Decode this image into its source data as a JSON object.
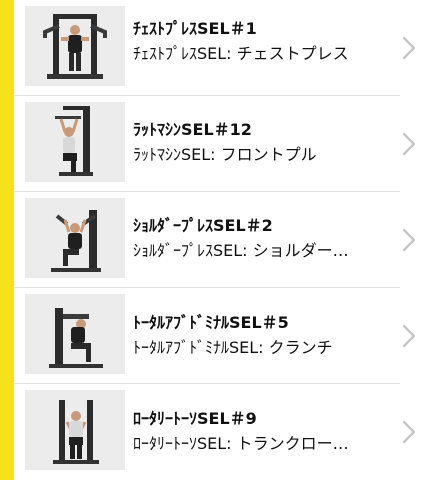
{
  "colors": {
    "accent": "#f7e11b",
    "thumb_bg": "#ececec",
    "chevron": "#c7c7cc"
  },
  "items": [
    {
      "title": "ﾁｪｽﾄﾌﾟﾚｽSEL＃1",
      "subtitle": "ﾁｪｽﾄﾌﾟﾚｽSEL: チェストプレス",
      "chevron_icon": "chevron-right-icon"
    },
    {
      "title": "ﾗｯﾄﾏｼﾝSEL＃12",
      "subtitle": "ﾗｯﾄﾏｼﾝSEL: フロントプル",
      "chevron_icon": "chevron-right-icon"
    },
    {
      "title": "ｼｮﾙﾀﾞｰﾌﾟﾚｽSEL＃2",
      "subtitle": "ｼｮﾙﾀﾞｰﾌﾟﾚｽSEL: ショルダー…",
      "chevron_icon": "chevron-right-icon"
    },
    {
      "title": "ﾄｰﾀﾙｱﾌﾞﾄﾞﾐﾅﾙSEL＃5",
      "subtitle": "ﾄｰﾀﾙｱﾌﾞﾄﾞﾐﾅﾙSEL: クランチ",
      "chevron_icon": "chevron-right-icon"
    },
    {
      "title": "ﾛｰﾀﾘｰﾄｰｿSEL＃9",
      "subtitle": "ﾛｰﾀﾘｰﾄｰｿSEL: トランクロー…",
      "chevron_icon": "chevron-right-icon"
    }
  ]
}
